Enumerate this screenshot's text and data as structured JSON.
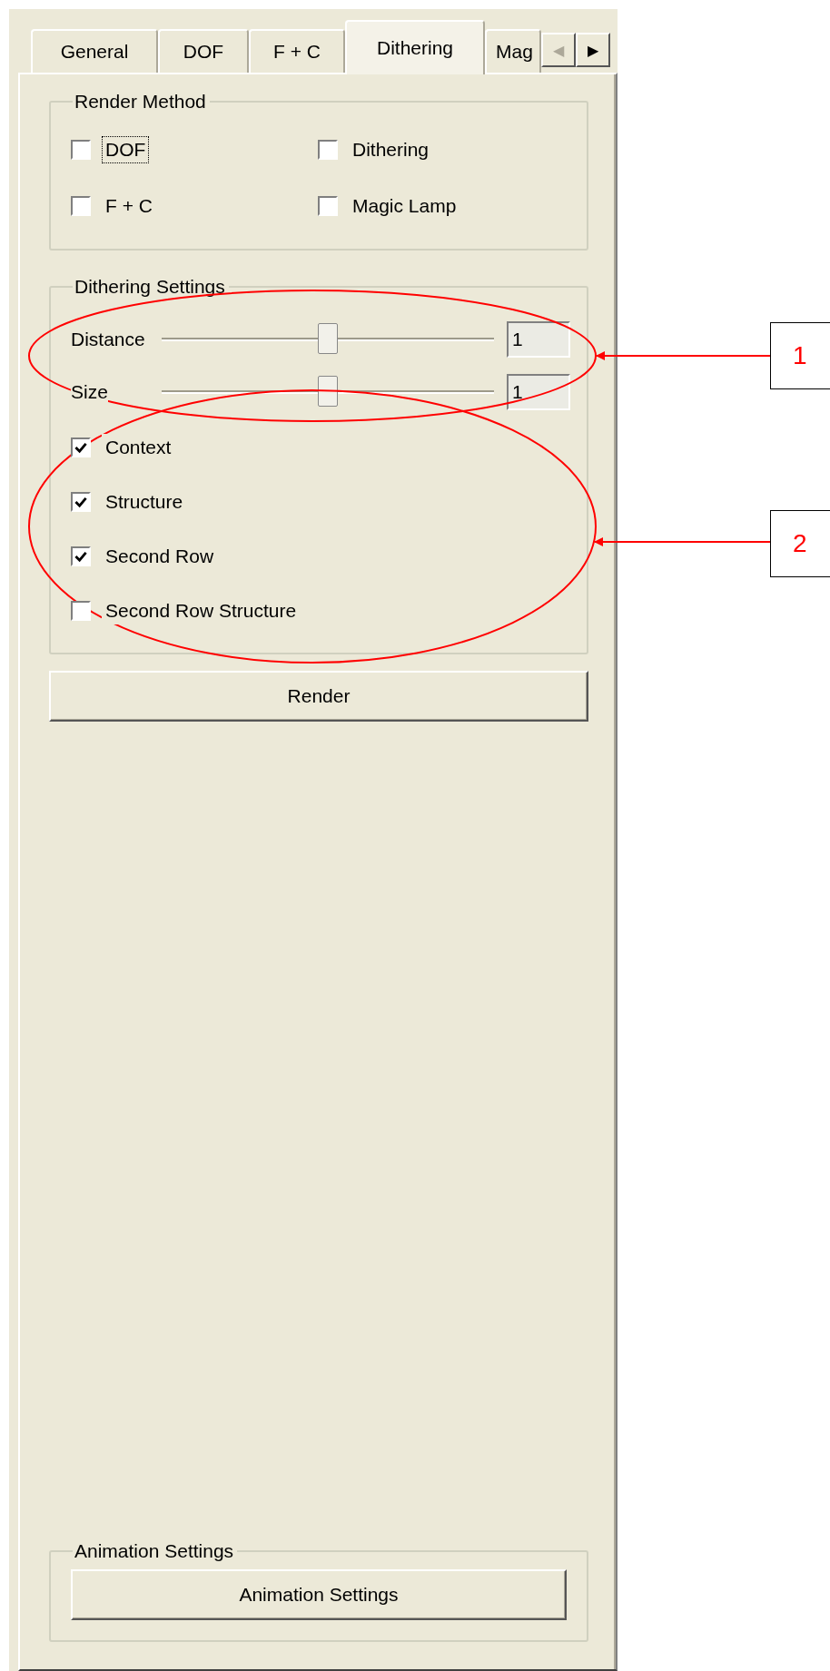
{
  "tabs": [
    {
      "label": "General",
      "selected": false
    },
    {
      "label": "DOF",
      "selected": false
    },
    {
      "label": "F + C",
      "selected": false
    },
    {
      "label": "Dithering",
      "selected": true
    },
    {
      "label": "Mag",
      "selected": false
    }
  ],
  "tab_scroll": {
    "left": {
      "label": "◀",
      "disabled": true
    },
    "right": {
      "label": "▶",
      "disabled": false
    }
  },
  "render_method": {
    "title": "Render Method",
    "options": [
      {
        "label": "DOF",
        "checked": false,
        "focused": true
      },
      {
        "label": "Dithering",
        "checked": false,
        "focused": false
      },
      {
        "label": "F + C",
        "checked": false,
        "focused": false
      },
      {
        "label": "Magic Lamp",
        "checked": false,
        "focused": false
      }
    ]
  },
  "dithering_settings": {
    "title": "Dithering Settings",
    "sliders": [
      {
        "label": "Distance",
        "level": 0.5,
        "value": "1"
      },
      {
        "label": "Size",
        "level": 0.5,
        "value": "1"
      }
    ],
    "options": [
      {
        "label": "Context",
        "checked": true
      },
      {
        "label": "Structure",
        "checked": true
      },
      {
        "label": "Second Row",
        "checked": true
      },
      {
        "label": "Second Row Structure",
        "checked": false
      }
    ]
  },
  "render_button": "Render",
  "animation_settings": {
    "title": "Animation Settings",
    "button": "Animation Settings"
  },
  "callouts": [
    {
      "label": "1"
    },
    {
      "label": "2"
    }
  ]
}
